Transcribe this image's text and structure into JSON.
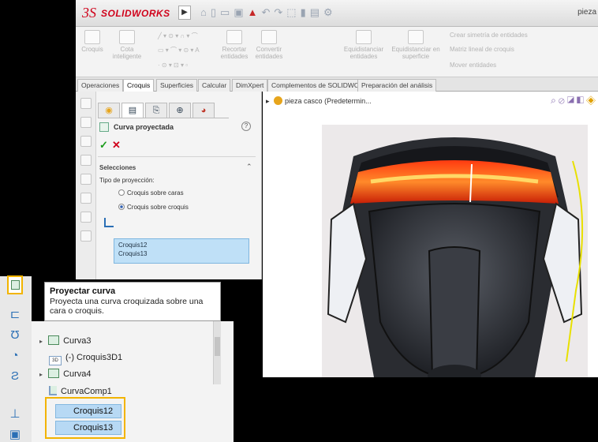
{
  "app": {
    "logo_ds": "3S",
    "logo_text": "SOLIDWORKS",
    "title_arrow": "▶",
    "quick_access_icons": [
      "home-icon",
      "new-icon",
      "open-icon",
      "save-icon",
      "print-icon",
      "undo-icon",
      "redo-icon",
      "select-icon",
      "rebuild-icon",
      "options-icon",
      "gear-icon"
    ],
    "document_title": "pieza"
  },
  "ribbon": {
    "buttons": [
      {
        "label": "Croquis",
        "icon": "sketch-icon"
      },
      {
        "label": "Cota inteligente",
        "icon": "smart-dimension-icon"
      },
      {
        "label": "Recortar entidades",
        "icon": "trim-icon"
      },
      {
        "label": "Convertir entidades",
        "icon": "convert-icon"
      },
      {
        "label": "Equidistanciar entidades",
        "icon": "offset-icon"
      },
      {
        "label": "Equidistanciar en superficie",
        "icon": "offset-surface-icon"
      }
    ],
    "right_items": [
      "Crear simetría de entidades",
      "Matriz lineal de croquis",
      "Mover entidades"
    ]
  },
  "tabs": [
    "Operaciones",
    "Croquis",
    "Superficies",
    "Calcular",
    "DimXpert",
    "Complementos de SOLIDWORKS",
    "Preparación del análisis"
  ],
  "active_tab": "Croquis",
  "property_manager": {
    "title": "Curva proyectada",
    "ok_symbol": "✓",
    "cancel_symbol": "✕",
    "help_symbol": "?",
    "group_title": "Selecciones",
    "group_caret": "⌃",
    "projection_label": "Tipo de proyección:",
    "option_1": "Croquis sobre caras",
    "option_2": "Croquis sobre croquis",
    "selected_option": "Croquis sobre croquis",
    "selections": [
      "Croquis12",
      "Croquis13"
    ]
  },
  "tooltip": {
    "title": "Proyectar curva",
    "description": "Proyecta una curva croquizada sobre una cara o croquis."
  },
  "feature_tree": {
    "rows": [
      {
        "label": "Curva3",
        "icon": "curve-icon",
        "expandable": true
      },
      {
        "label": "(-) Croquis3D1",
        "icon": "sketch3d-icon",
        "expandable": false
      },
      {
        "label": "Curva4",
        "icon": "curve-icon",
        "expandable": true
      },
      {
        "label": "CurvaComp1",
        "icon": "composite-curve-icon",
        "expandable": false
      }
    ],
    "highlighted": [
      "Croquis12",
      "Croquis13"
    ],
    "sketch3d_badge": "3D"
  },
  "viewport": {
    "part_label": "pieza casco",
    "config_label": "(Predetermin...",
    "tools": [
      "search-icon",
      "zoom-icon",
      "section-icon",
      "view-icon",
      "display-icon"
    ]
  },
  "colors": {
    "brand_red": "#d0021b",
    "highlight_yellow": "#f2b400",
    "selection_blue": "#b7d9f4",
    "visor_orange": "#ff4a12"
  }
}
